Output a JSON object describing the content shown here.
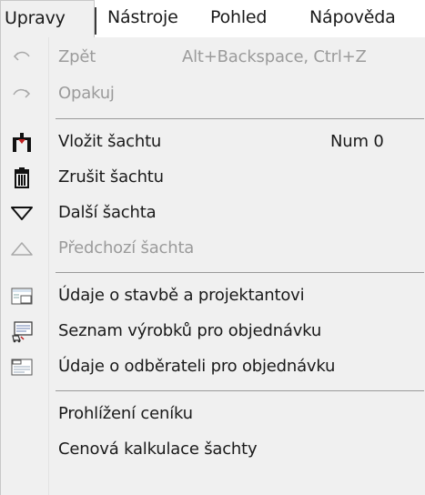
{
  "menubar": {
    "items": [
      {
        "label": "Upravy"
      },
      {
        "label": "Nástroje"
      },
      {
        "label": "Pohled"
      },
      {
        "label": "Nápověda"
      }
    ]
  },
  "menu": {
    "items": [
      {
        "label": "Zpět",
        "shortcut": "Alt+Backspace, Ctrl+Z",
        "enabled": false,
        "icon": "undo-icon"
      },
      {
        "label": "Opakuj",
        "shortcut": "",
        "enabled": false,
        "icon": "redo-icon"
      },
      {
        "label": "Vložit šachtu",
        "shortcut": "Num 0",
        "enabled": true,
        "icon": "insert-shaft-icon"
      },
      {
        "label": "Zrušit šachtu",
        "shortcut": "",
        "enabled": true,
        "icon": "trash-icon"
      },
      {
        "label": "Další šachta",
        "shortcut": "",
        "enabled": true,
        "icon": "triangle-down-icon"
      },
      {
        "label": "Předchozí šachta",
        "shortcut": "",
        "enabled": false,
        "icon": "triangle-up-icon"
      },
      {
        "label": "Údaje o stavbě a projektantovi",
        "shortcut": "",
        "enabled": true,
        "icon": "building-form-icon"
      },
      {
        "label": "Seznam výrobků pro objednávku",
        "shortcut": "",
        "enabled": true,
        "icon": "product-list-icon"
      },
      {
        "label": "Údaje o odběrateli pro objednávku",
        "shortcut": "",
        "enabled": true,
        "icon": "customer-form-icon"
      },
      {
        "label": "Prohlížení ceníku",
        "shortcut": "",
        "enabled": true,
        "icon": ""
      },
      {
        "label": "Cenová kalkulace šachty",
        "shortcut": "",
        "enabled": true,
        "icon": ""
      }
    ]
  }
}
